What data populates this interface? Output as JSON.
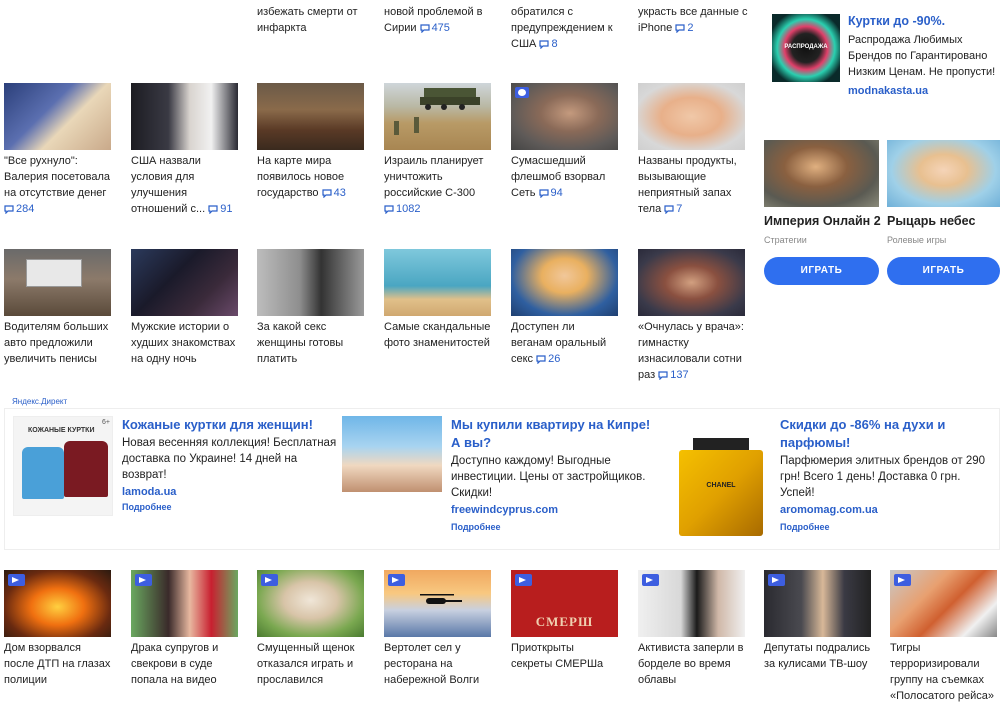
{
  "top_row": [
    {
      "title": "избежать смерти от инфаркта",
      "count": ""
    },
    {
      "title": "новой проблемой в Сирии",
      "count": "475"
    },
    {
      "title": "обратился с предупреждением к США",
      "count": "8"
    },
    {
      "title": "украсть все данные с iPhone",
      "count": "2"
    }
  ],
  "news_row1": [
    {
      "title": "\"Все рухнуло\": Валерия посетовала на отсутствие денег",
      "count": "284"
    },
    {
      "title": "США назвали условия для улучшения отношений с...",
      "count": "91"
    },
    {
      "title": "На карте мира появилось новое государство",
      "count": "43"
    },
    {
      "title": "Израиль планирует уничтожить российские С-300",
      "count": "1082"
    },
    {
      "title": "Сумасшедший флешмоб взорвал Сеть",
      "count": "94"
    },
    {
      "title": "Названы продукты, вызывающие неприятный запах тела",
      "count": "7"
    }
  ],
  "news_row2": [
    {
      "title": "Водителям больших авто предложили увеличить пенисы",
      "count": ""
    },
    {
      "title": "Мужские истории о худших знакомствах на одну ночь",
      "count": ""
    },
    {
      "title": "За какой секс женщины готовы платить",
      "count": ""
    },
    {
      "title": "Самые скандальные фото знаменитостей",
      "count": ""
    },
    {
      "title": "Доступен ли веганам оральный секс",
      "count": "26"
    },
    {
      "title": "«Очнулась у врача»: гимнастку изнасиловали сотни раз",
      "count": "137"
    }
  ],
  "sidebar": {
    "ad": {
      "title": "Куртки до -90%.",
      "text": "Распродажа Любимых Брендов по Гарантировано Низким Ценам. Не пропусти!",
      "domain": "modnakasta.ua",
      "badge": "РАСПРОДАЖА"
    },
    "games": [
      {
        "name": "Империя Онлайн 2",
        "genre": "Стратегии",
        "button": "ИГРАТЬ"
      },
      {
        "name": "Рыцарь небес",
        "genre": "Ролевые игры",
        "button": "ИГРАТЬ"
      }
    ]
  },
  "direct": {
    "label": "Яндекс.Директ",
    "ads": [
      {
        "title": "Кожаные куртки для женщин!",
        "text": "Новая весенняя коллекция! Бесплатная доставка по Украине! 14 дней на возврат!",
        "domain": "lamoda.ua",
        "more": "Подробнее",
        "img_caption": "КОЖАНЫЕ КУРТКИ",
        "age": "6+"
      },
      {
        "title": "Мы купили квартиру на Кипре! А вы?",
        "text": "Доступно каждому! Выгодные инвестиции. Цены от застройщиков. Скидки!",
        "domain": "freewindcyprus.com",
        "more": "Подробнее"
      },
      {
        "title": "Скидки до -86% на духи и парфюмы!",
        "text": "Парфюмерия элитных брендов от 290 грн! Всего 1 день! Доставка 0 грн. Успей!",
        "domain": "aromomag.com.ua",
        "more": "Подробнее",
        "img_caption": "CHANEL"
      }
    ]
  },
  "video_row": [
    {
      "title": "Дом взорвался после ДТП на глазах полиции"
    },
    {
      "title": "Драка супругов и свекрови в суде попала на видео"
    },
    {
      "title": "Смущенный щенок отказался играть и прославился"
    },
    {
      "title": "Вертолет сел у ресторана на набережной Волги"
    },
    {
      "title": "Приоткрыты секреты СМЕРШа",
      "img_caption": "СМЕРШ"
    },
    {
      "title": "Активиста заперли в борделе во время облавы"
    },
    {
      "title": "Депутаты подрались за кулисами ТВ-шоу"
    },
    {
      "title": "Тигры терроризировали группу на съемках «Полосатого рейса»"
    }
  ]
}
